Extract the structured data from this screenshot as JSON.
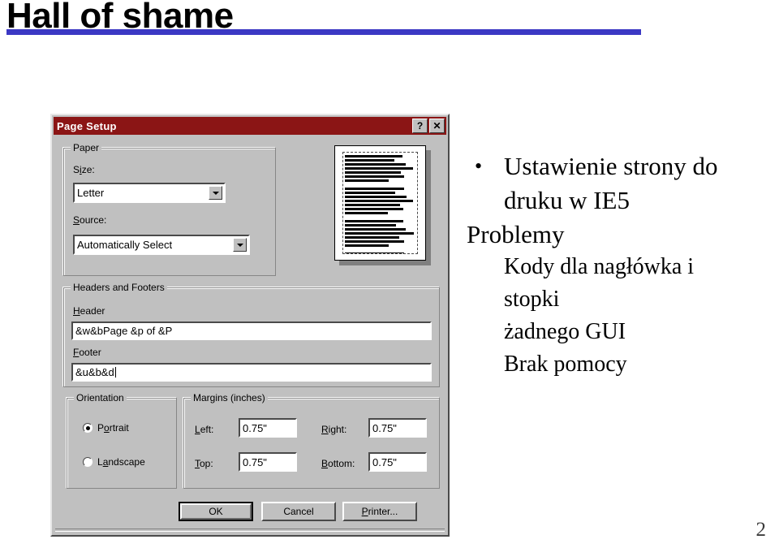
{
  "slide": {
    "title": "Hall of shame",
    "page_number": "2",
    "accent_color": "#3b38c4"
  },
  "body": {
    "bullet_glyph": "•",
    "lines": [
      {
        "level": 1,
        "text": "Ustawienie strony do"
      },
      {
        "level": 1,
        "text": "druku w IE5"
      },
      {
        "level": 2,
        "text": "Problemy"
      },
      {
        "level": 3,
        "text": "Kody dla nagłówka i"
      },
      {
        "level": 3,
        "text": "stopki"
      },
      {
        "level": 3,
        "text": "żadnego GUI"
      },
      {
        "level": 3,
        "text": "Brak pomocy"
      }
    ]
  },
  "dialog": {
    "title": "Page Setup",
    "titlebar_color": "#8b1515",
    "face_color": "#c0c0c0",
    "help_button": "?",
    "close_button": "✕",
    "paper": {
      "group_label": "Paper",
      "size_label": "Size:",
      "size_value": "Letter",
      "source_label": "Source:",
      "source_value": "Automatically Select"
    },
    "headers_footers": {
      "group_label": "Headers and Footers",
      "header_label": "Header",
      "header_value": "&w&bPage &p of &P",
      "footer_label": "Footer",
      "footer_value": "&u&b&d"
    },
    "orientation": {
      "group_label": "Orientation",
      "options": [
        {
          "label": "Portrait",
          "selected": true
        },
        {
          "label": "Landscape",
          "selected": false
        }
      ]
    },
    "margins": {
      "group_label": "Margins (inches)",
      "fields": [
        {
          "label": "Left:",
          "value": "0.75\""
        },
        {
          "label": "Right:",
          "value": "0.75\""
        },
        {
          "label": "Top:",
          "value": "0.75\""
        },
        {
          "label": "Bottom:",
          "value": "0.75\""
        }
      ]
    },
    "buttons": [
      {
        "label": "OK",
        "default": true
      },
      {
        "label": "Cancel",
        "default": false
      },
      {
        "label": "Printer...",
        "default": false
      }
    ]
  }
}
